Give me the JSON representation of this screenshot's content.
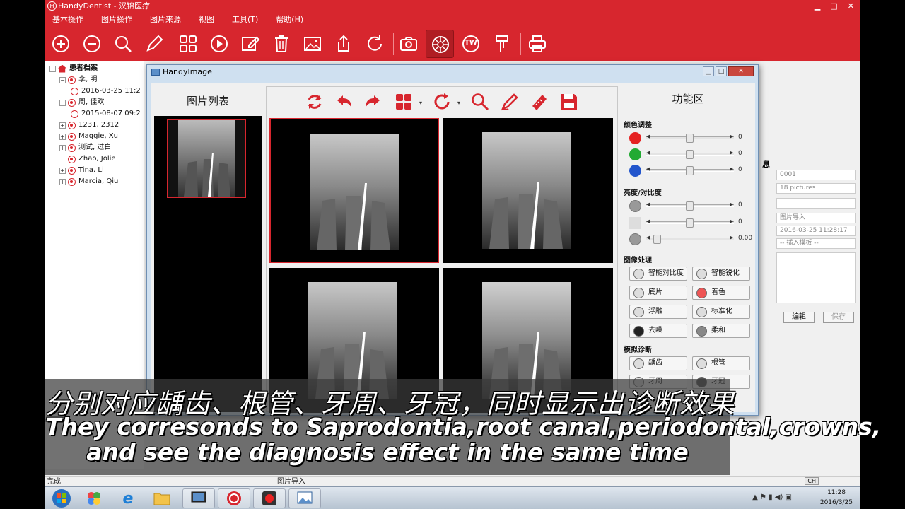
{
  "app": {
    "title": "HandyDentist - 汉锦医疗",
    "logo_text": "H",
    "menus": [
      "基本操作",
      "图片操作",
      "图片来源",
      "视图",
      "工具(T)",
      "帮助(H)"
    ],
    "toolbar_icons": [
      "zoom-in-icon",
      "zoom-out-icon",
      "search-icon",
      "pencil-icon",
      "layout-grid-icon",
      "play-icon",
      "edit-icon",
      "trash-icon",
      "image-icon",
      "export-icon",
      "refresh-icon",
      "camera-icon",
      "sensor-icon",
      "tw-icon",
      "tool-icon",
      "printer-icon"
    ],
    "toolbar_tw_label": "TW",
    "accent": "#d7262e"
  },
  "tree": {
    "root": "患者档案",
    "items": [
      {
        "label": "李, 明",
        "expand": "−",
        "level": 1,
        "kind": "person"
      },
      {
        "label": "2016-03-25 11:2",
        "level": 2,
        "kind": "visit"
      },
      {
        "label": "周, 佳欢",
        "expand": "−",
        "level": 1,
        "kind": "person"
      },
      {
        "label": "2015-08-07 09:2",
        "level": 2,
        "kind": "visit"
      },
      {
        "label": "1231, 2312",
        "expand": "+",
        "level": 1,
        "kind": "person"
      },
      {
        "label": "Maggie, Xu",
        "expand": "+",
        "level": 1,
        "kind": "person"
      },
      {
        "label": "测试, 过白",
        "expand": "+",
        "level": 1,
        "kind": "person"
      },
      {
        "label": "Zhao, Jolie",
        "expand": "",
        "level": 1,
        "kind": "person"
      },
      {
        "label": "Tina, Li",
        "expand": "+",
        "level": 1,
        "kind": "person"
      },
      {
        "label": "Marcia, Qiu",
        "expand": "+",
        "level": 1,
        "kind": "person"
      }
    ]
  },
  "info": {
    "title_tail": "息",
    "fields": [
      "0001",
      "18 pictures",
      "",
      "图片导入",
      "2016-03-25 11:28:17",
      "-- 插入模板 --"
    ],
    "edit_label": "编辑",
    "save_label": "保存"
  },
  "status": {
    "left": "完成",
    "middle": "图片导入"
  },
  "dialog": {
    "title": "HandyImage",
    "piclist_title": "图片列表",
    "func_title": "功能区",
    "color_section": "颜色调整",
    "color_sliders": [
      {
        "color": "#e52222",
        "value": "0"
      },
      {
        "color": "#22aa33",
        "value": "0"
      },
      {
        "color": "#2255cc",
        "value": "0"
      }
    ],
    "bc_section": "亮度/对比度",
    "bc_sliders": [
      {
        "value": "0"
      },
      {
        "value": "0"
      },
      {
        "value": "0.00"
      }
    ],
    "proc_section": "图像处理",
    "proc_buttons": [
      "智能对比度",
      "智能锐化",
      "底片",
      "着色",
      "浮雕",
      "标准化",
      "去噪",
      "柔和"
    ],
    "diag_section": "模拟诊断",
    "diag_buttons": [
      "龋齿",
      "根管",
      "牙周",
      "牙冠"
    ]
  },
  "taskbar": {
    "lang": "CH",
    "time": "11:28",
    "date": "2016/3/25"
  },
  "subtitles": {
    "zh": "分别对应龋齿、根管、牙周、牙冠，同时显示出诊断效果",
    "en_line1": "They corresonds to Saprodontia,root canal,periodontal,crowns,",
    "en_line2": "and see the diagnosis effect in the same time"
  }
}
